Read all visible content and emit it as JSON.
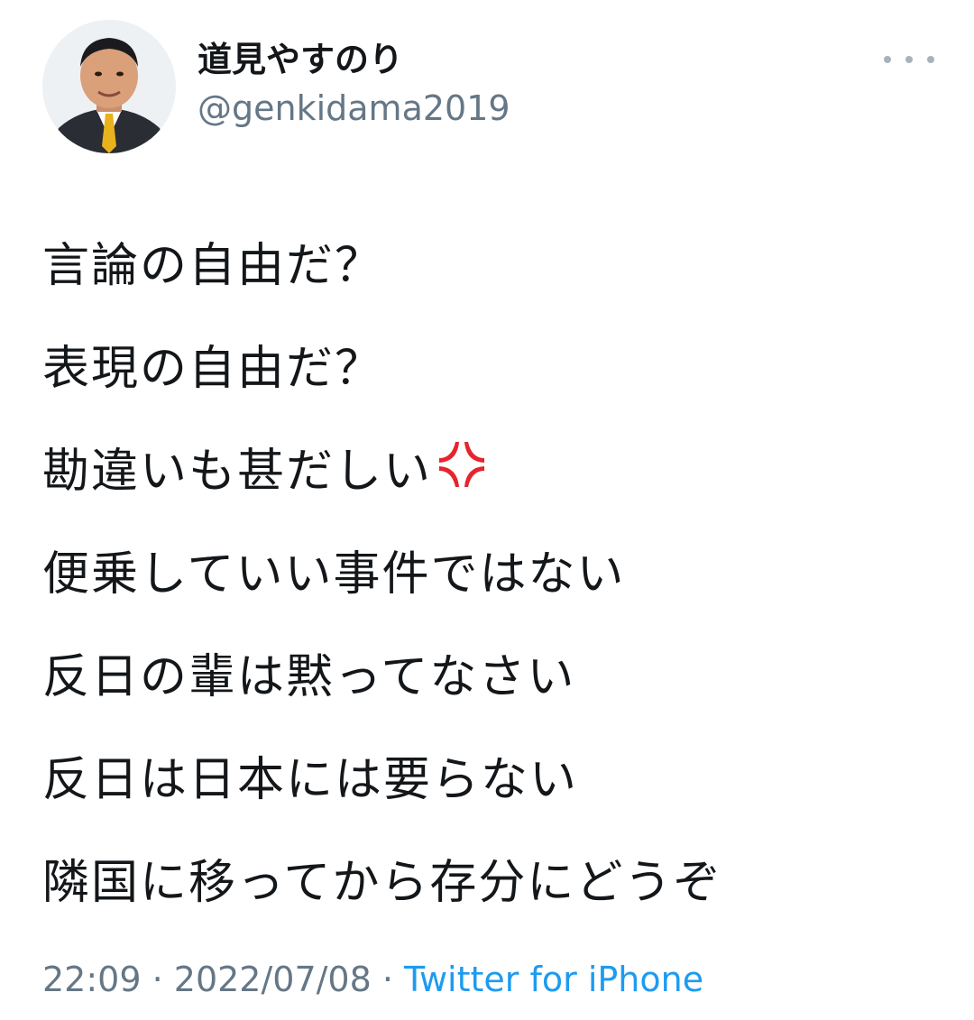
{
  "user": {
    "display_name": "道見やすのり",
    "handle": "@genkidama2019"
  },
  "tweet": {
    "lines": [
      "言論の自由だ？",
      "表現の自由だ？",
      "勘違いも甚だしい",
      "便乗していい事件ではない",
      "反日の輩は黙ってなさい",
      "反日は日本には要らない",
      "隣国に移ってから存分にどうぞ"
    ],
    "anger_emoji_icon": "anger-symbol-icon"
  },
  "meta": {
    "time": "22:09",
    "separator": " · ",
    "date": "2022/07/08",
    "source": "Twitter for iPhone"
  },
  "colors": {
    "text": "#14171a",
    "secondary": "#657786",
    "link": "#1d9bf0",
    "emoji": "#e5242f"
  }
}
